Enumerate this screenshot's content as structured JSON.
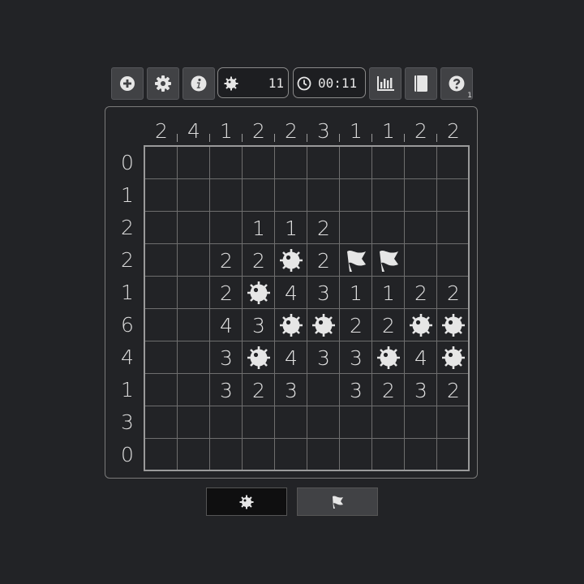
{
  "toolbar": {
    "buttons": [
      {
        "name": "new-game-button",
        "icon": "plus-circle-icon"
      },
      {
        "name": "settings-button",
        "icon": "gear-icon"
      },
      {
        "name": "info-button",
        "icon": "info-icon"
      },
      {
        "name": "stats-button",
        "icon": "bar-chart-icon"
      },
      {
        "name": "rules-button",
        "icon": "book-icon"
      },
      {
        "name": "help-button",
        "icon": "question-icon",
        "badge": "1"
      }
    ],
    "mines_remaining": "11",
    "timer": "00:11"
  },
  "puzzle": {
    "col_clues": [
      "2",
      "4",
      "1",
      "2",
      "2",
      "3",
      "1",
      "1",
      "2",
      "2"
    ],
    "row_clues": [
      "0",
      "1",
      "2",
      "2",
      "1",
      "6",
      "4",
      "1",
      "3",
      "0"
    ],
    "cells": [
      [
        "",
        "",
        "",
        "",
        "",
        "",
        "",
        "",
        "",
        ""
      ],
      [
        "",
        "",
        "",
        "",
        "",
        "",
        "",
        "",
        "",
        ""
      ],
      [
        "",
        "",
        "",
        "1",
        "1",
        "2",
        "",
        "",
        "",
        ""
      ],
      [
        "",
        "",
        "2",
        "2",
        "M",
        "2",
        "F",
        "F",
        "",
        ""
      ],
      [
        "",
        "",
        "2",
        "M",
        "4",
        "3",
        "1",
        "1",
        "2",
        "2"
      ],
      [
        "",
        "",
        "4",
        "3",
        "M",
        "M",
        "2",
        "2",
        "M",
        "M"
      ],
      [
        "",
        "",
        "3",
        "M",
        "4",
        "3",
        "3",
        "M",
        "4",
        "M"
      ],
      [
        "",
        "",
        "3",
        "2",
        "3",
        "",
        "3",
        "2",
        "3",
        "2"
      ],
      [
        "",
        "",
        "",
        "",
        "",
        "",
        "",
        "",
        "",
        ""
      ],
      [
        "",
        "",
        "",
        "",
        "",
        "",
        "",
        "",
        "",
        ""
      ]
    ]
  },
  "modes": [
    {
      "name": "mine-mode-button",
      "icon": "mine-icon",
      "active": true
    },
    {
      "name": "flag-mode-button",
      "icon": "flag-icon",
      "active": false
    }
  ],
  "colors": {
    "background": "#222326",
    "button": "#414245",
    "text": "#dcdcdc"
  }
}
